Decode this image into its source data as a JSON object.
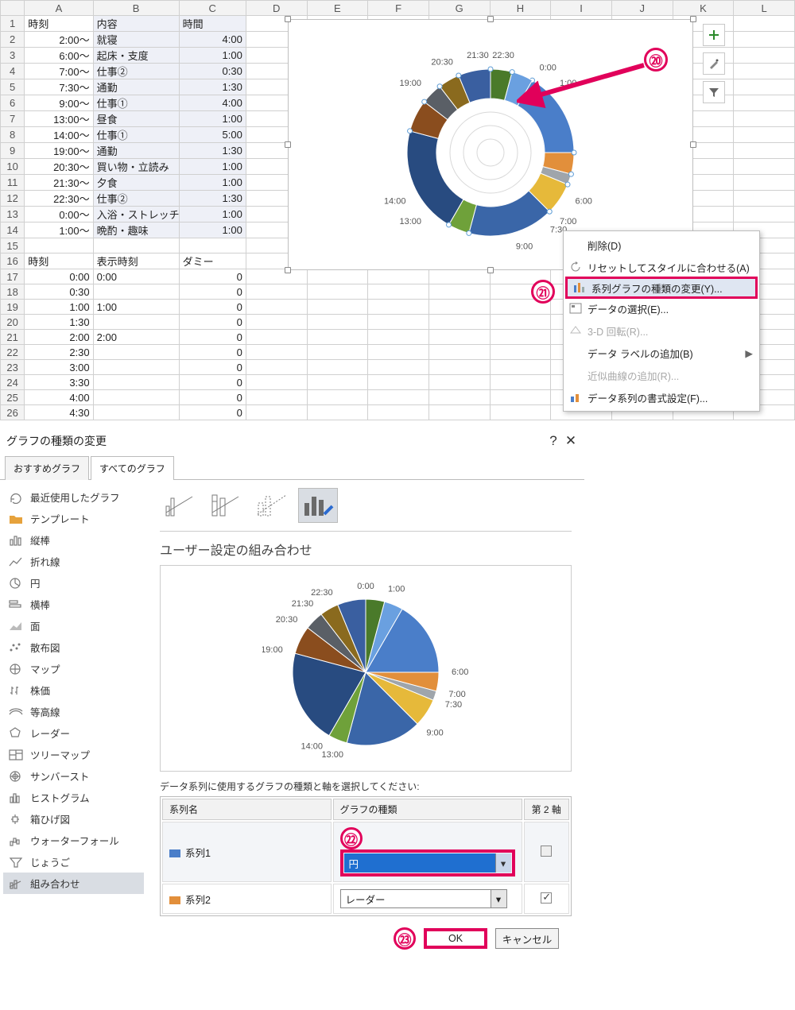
{
  "spreadsheet": {
    "cols": [
      "A",
      "B",
      "C",
      "D",
      "E",
      "F",
      "G",
      "H",
      "I",
      "J",
      "K",
      "L"
    ],
    "headers1": {
      "A": "時刻",
      "B": "内容",
      "C": "時間"
    },
    "rows1": [
      {
        "n": 2,
        "A": "2:00～",
        "B": "就寝",
        "C": "4:00"
      },
      {
        "n": 3,
        "A": "6:00～",
        "B": "起床・支度",
        "C": "1:00"
      },
      {
        "n": 4,
        "A": "7:00～",
        "B": "仕事②",
        "C": "0:30"
      },
      {
        "n": 5,
        "A": "7:30～",
        "B": "通勤",
        "C": "1:30"
      },
      {
        "n": 6,
        "A": "9:00～",
        "B": "仕事①",
        "C": "4:00"
      },
      {
        "n": 7,
        "A": "13:00～",
        "B": "昼食",
        "C": "1:00"
      },
      {
        "n": 8,
        "A": "14:00～",
        "B": "仕事①",
        "C": "5:00"
      },
      {
        "n": 9,
        "A": "19:00～",
        "B": "通勤",
        "C": "1:30"
      },
      {
        "n": 10,
        "A": "20:30～",
        "B": "買い物・立読み",
        "C": "1:00"
      },
      {
        "n": 11,
        "A": "21:30～",
        "B": "夕食",
        "C": "1:00"
      },
      {
        "n": 12,
        "A": "22:30～",
        "B": "仕事②",
        "C": "1:30"
      },
      {
        "n": 13,
        "A": "0:00～",
        "B": "入浴・ストレッチ",
        "C": "1:00"
      },
      {
        "n": 14,
        "A": "1:00～",
        "B": "晩酌・趣味",
        "C": "1:00"
      }
    ],
    "headers2": {
      "A": "時刻",
      "B": "表示時刻",
      "C": "ダミー"
    },
    "rows2": [
      {
        "n": 17,
        "A": "0:00",
        "B": "0:00",
        "C": "0"
      },
      {
        "n": 18,
        "A": "0:30",
        "B": "",
        "C": "0"
      },
      {
        "n": 19,
        "A": "1:00",
        "B": "1:00",
        "C": "0"
      },
      {
        "n": 20,
        "A": "1:30",
        "B": "",
        "C": "0"
      },
      {
        "n": 21,
        "A": "2:00",
        "B": "2:00",
        "C": "0"
      },
      {
        "n": 22,
        "A": "2:30",
        "B": "",
        "C": "0"
      },
      {
        "n": 23,
        "A": "3:00",
        "B": "",
        "C": "0"
      },
      {
        "n": 24,
        "A": "3:30",
        "B": "",
        "C": "0"
      },
      {
        "n": 25,
        "A": "4:00",
        "B": "",
        "C": "0"
      },
      {
        "n": 26,
        "A": "4:30",
        "B": "",
        "C": "0"
      }
    ]
  },
  "chart_data": [
    {
      "type": "pie",
      "role": "doughnut-ring",
      "categories": [
        "2:00～",
        "6:00～",
        "7:00～",
        "7:30～",
        "9:00～",
        "13:00～",
        "14:00～",
        "19:00～",
        "20:30～",
        "21:30～",
        "22:30～",
        "0:00～",
        "1:00～"
      ],
      "minutes": [
        240,
        60,
        30,
        90,
        240,
        60,
        300,
        90,
        60,
        60,
        90,
        60,
        60
      ],
      "labels": [
        "0:00",
        "1:00",
        "6:00",
        "7:00",
        "7:30",
        "9:00",
        "13:00",
        "14:00",
        "19:00",
        "20:30",
        "21:30",
        "22:30"
      ],
      "colors": [
        "#4a7ec9",
        "#e28f3b",
        "#9fa5ab",
        "#e6b93a",
        "#3a66a8",
        "#6fa13a",
        "#284b80",
        "#8a4d1e",
        "#5a5f66",
        "#8a6a1e",
        "#3a5fa0",
        "#4a7a2a",
        "#6aa0e0"
      ],
      "title": ""
    },
    {
      "type": "pie",
      "role": "dialog-preview",
      "categories": [
        "2:00～",
        "6:00～",
        "7:00～",
        "7:30～",
        "9:00～",
        "13:00～",
        "14:00～",
        "19:00～",
        "20:30～",
        "21:30～",
        "22:30～",
        "0:00～",
        "1:00～"
      ],
      "minutes": [
        240,
        60,
        30,
        90,
        240,
        60,
        300,
        90,
        60,
        60,
        90,
        60,
        60
      ],
      "labels_shown": [
        "0:00",
        "1:00",
        "6:00",
        "7:00",
        "7:30",
        "9:00",
        "13:00",
        "14:00",
        "19:00",
        "20:30",
        "21:30",
        "22:30"
      ]
    }
  ],
  "context_menu": {
    "items": [
      {
        "label": "削除(D)",
        "icon": "",
        "enabled": true
      },
      {
        "label": "リセットしてスタイルに合わせる(A)",
        "icon": "reset",
        "enabled": true
      },
      {
        "label": "系列グラフの種類の変更(Y)...",
        "icon": "chart-type",
        "enabled": true,
        "highlight": true
      },
      {
        "label": "データの選択(E)...",
        "icon": "select-data",
        "enabled": true
      },
      {
        "label": "3-D 回転(R)...",
        "icon": "rotate3d",
        "enabled": false
      },
      {
        "label": "データ ラベルの追加(B)",
        "icon": "",
        "enabled": true,
        "submenu": true
      },
      {
        "label": "近似曲線の追加(R)...",
        "icon": "",
        "enabled": false
      },
      {
        "label": "データ系列の書式設定(F)...",
        "icon": "format",
        "enabled": true
      }
    ]
  },
  "annotations": {
    "a20": "⑳",
    "a21": "㉑",
    "a22": "㉒",
    "a23": "㉓"
  },
  "dialog": {
    "title": "グラフの種類の変更",
    "tabs": [
      "おすすめグラフ",
      "すべてのグラフ"
    ],
    "active_tab": 1,
    "side_items": [
      {
        "icon": "recent",
        "label": "最近使用したグラフ"
      },
      {
        "icon": "folder",
        "label": "テンプレート"
      },
      {
        "icon": "column",
        "label": "縦棒"
      },
      {
        "icon": "line",
        "label": "折れ線"
      },
      {
        "icon": "pie",
        "label": "円"
      },
      {
        "icon": "bar",
        "label": "横棒"
      },
      {
        "icon": "area",
        "label": "面"
      },
      {
        "icon": "scatter",
        "label": "散布図"
      },
      {
        "icon": "map",
        "label": "マップ"
      },
      {
        "icon": "stock",
        "label": "株価"
      },
      {
        "icon": "surface",
        "label": "等高線"
      },
      {
        "icon": "radar",
        "label": "レーダー"
      },
      {
        "icon": "treemap",
        "label": "ツリーマップ"
      },
      {
        "icon": "sunburst",
        "label": "サンバースト"
      },
      {
        "icon": "histogram",
        "label": "ヒストグラム"
      },
      {
        "icon": "boxw",
        "label": "箱ひげ図"
      },
      {
        "icon": "waterfall",
        "label": "ウォーターフォール"
      },
      {
        "icon": "funnel",
        "label": "じょうご"
      },
      {
        "icon": "combo",
        "label": "組み合わせ"
      }
    ],
    "active_side": 18,
    "heading": "ユーザー設定の組み合わせ",
    "caption": "データ系列に使用するグラフの種類と軸を選択してください:",
    "table": {
      "cols": [
        "系列名",
        "グラフの種類",
        "第 2 軸"
      ],
      "rows": [
        {
          "color": "#4a7ec9",
          "name": "系列1",
          "type": "円",
          "axis2": false,
          "axis2_disabled": true,
          "highlight": true
        },
        {
          "color": "#e28f3b",
          "name": "系列2",
          "type": "レーダー",
          "axis2": true,
          "axis2_disabled": false
        }
      ]
    },
    "buttons": {
      "ok": "OK",
      "cancel": "キャンセル"
    }
  }
}
